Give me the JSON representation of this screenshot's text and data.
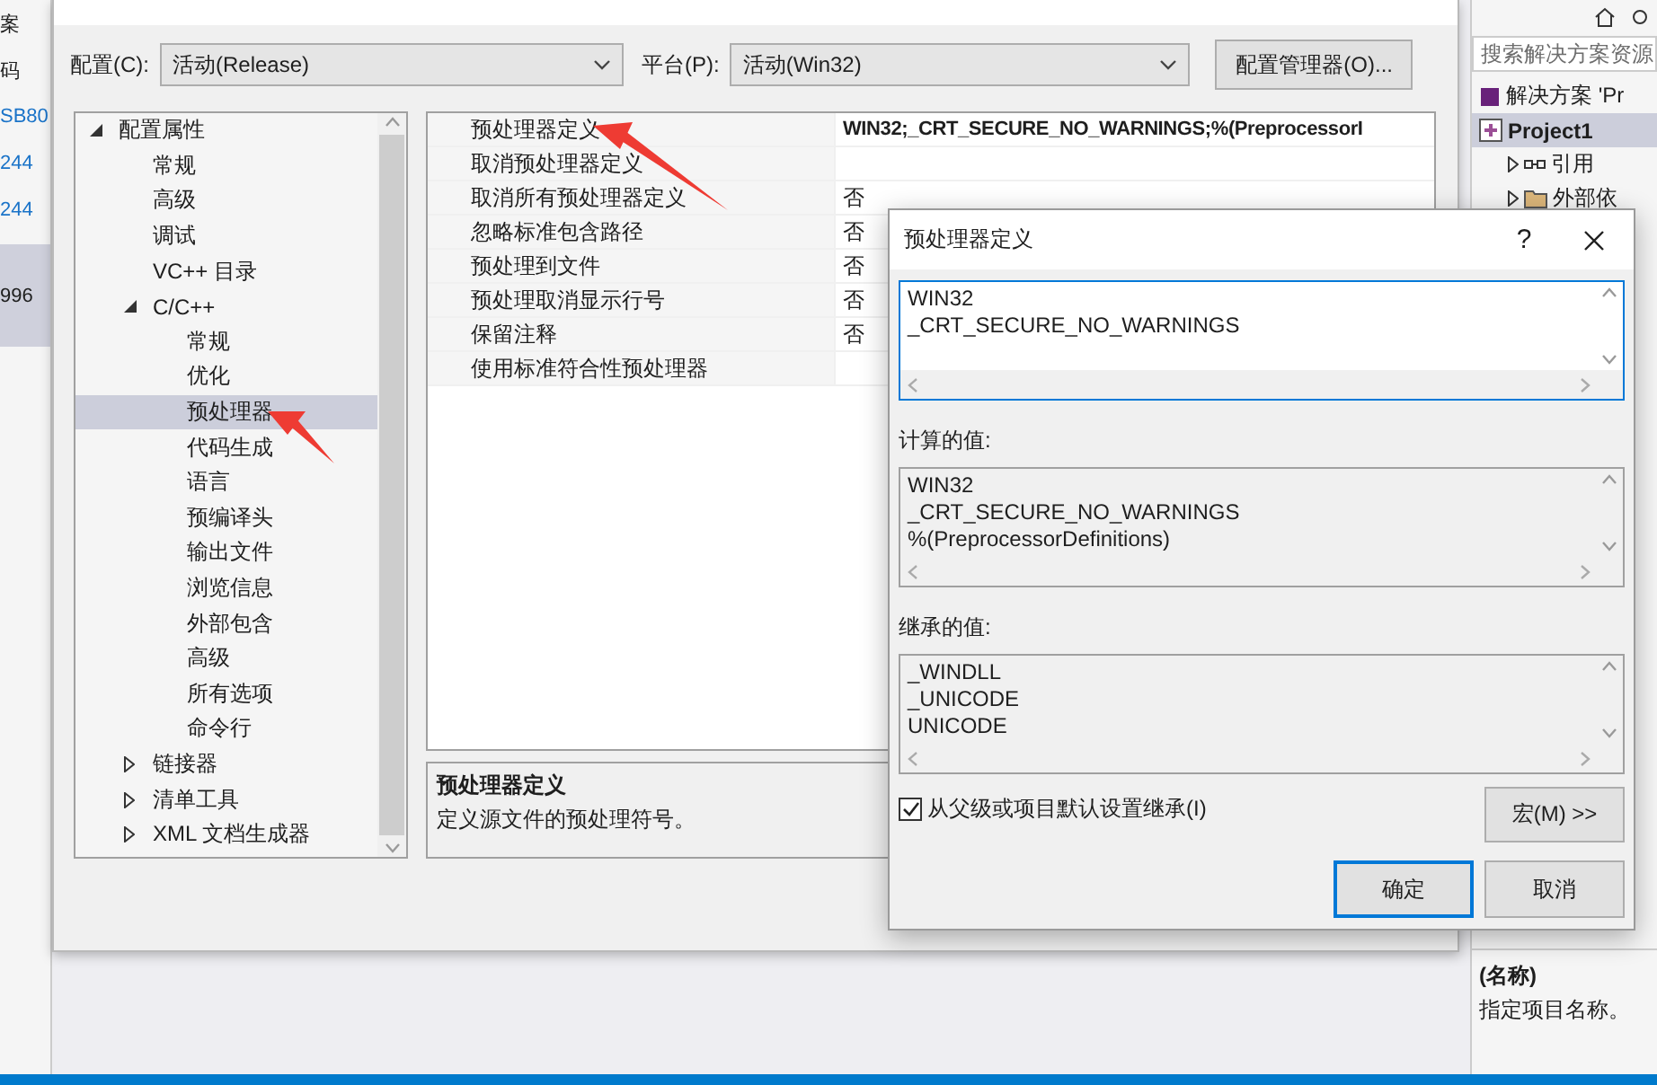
{
  "left_strip": [
    {
      "text": "案",
      "link": false,
      "selected": false
    },
    {
      "text": "码",
      "link": false,
      "selected": false
    },
    {
      "text": "SB80",
      "link": true,
      "selected": false
    },
    {
      "text": "244",
      "link": true,
      "selected": false
    },
    {
      "text": "244",
      "link": true,
      "selected": false
    },
    {
      "text": "996",
      "link": false,
      "selected": true
    }
  ],
  "config_bar": {
    "config_label": "配置(C):",
    "config_value": "活动(Release)",
    "platform_label": "平台(P):",
    "platform_value": "活动(Win32)",
    "manager_button": "配置管理器(O)..."
  },
  "tree": [
    {
      "label": "配置属性",
      "expanded": true,
      "selected": false,
      "children": [
        {
          "label": "常规",
          "selected": false
        },
        {
          "label": "高级",
          "selected": false
        },
        {
          "label": "调试",
          "selected": false
        },
        {
          "label": "VC++ 目录",
          "selected": false
        },
        {
          "label": "C/C++",
          "expanded": true,
          "selected": false,
          "children": [
            {
              "label": "常规",
              "selected": false
            },
            {
              "label": "优化",
              "selected": false
            },
            {
              "label": "预处理器",
              "selected": true
            },
            {
              "label": "代码生成",
              "selected": false
            },
            {
              "label": "语言",
              "selected": false
            },
            {
              "label": "预编译头",
              "selected": false
            },
            {
              "label": "输出文件",
              "selected": false
            },
            {
              "label": "浏览信息",
              "selected": false
            },
            {
              "label": "外部包含",
              "selected": false
            },
            {
              "label": "高级",
              "selected": false
            },
            {
              "label": "所有选项",
              "selected": false
            },
            {
              "label": "命令行",
              "selected": false
            }
          ]
        },
        {
          "label": "链接器",
          "expanded": false,
          "selected": false
        },
        {
          "label": "清单工具",
          "expanded": false,
          "selected": false
        },
        {
          "label": "XML 文档生成器",
          "expanded": false,
          "selected": false
        }
      ]
    }
  ],
  "properties": [
    {
      "name": "预处理器定义",
      "value": "WIN32;_CRT_SECURE_NO_WARNINGS;%(PreprocessorI",
      "overridden": true
    },
    {
      "name": "取消预处理器定义"
    },
    {
      "name": "取消所有预处理器定义",
      "value": "否",
      "overridden": false
    },
    {
      "name": "忽略标准包含路径",
      "value": "否",
      "overridden": false
    },
    {
      "name": "预处理到文件",
      "value": "否",
      "overridden": false
    },
    {
      "name": "预处理取消显示行号",
      "value": "否",
      "overridden": false
    },
    {
      "name": "保留注释",
      "value": "否",
      "overridden": false
    },
    {
      "name": "使用标准符合性预处理器"
    }
  ],
  "description": {
    "title": "预处理器定义",
    "text": "定义源文件的预处理符号。"
  },
  "solution_explorer": {
    "search_placeholder": "搜索解决方案资源",
    "items": [
      {
        "label": "解决方案 'Pr",
        "kind": "solution",
        "selected": false
      },
      {
        "label": "Project1",
        "kind": "project",
        "selected": true
      },
      {
        "label": "引用",
        "kind": "references",
        "selected": false
      },
      {
        "label": "外部依",
        "kind": "folder",
        "selected": false
      }
    ],
    "property_title": "(名称)",
    "property_text": "指定项目名称。"
  },
  "dialog": {
    "title": "预处理器定义",
    "help": "?",
    "definitions": [
      "WIN32",
      "_CRT_SECURE_NO_WARNINGS"
    ],
    "computed_label": "计算的值:",
    "computed": [
      "WIN32",
      "_CRT_SECURE_NO_WARNINGS",
      "%(PreprocessorDefinitions)"
    ],
    "inherited_label": "继承的值:",
    "inherited": [
      "_WINDLL",
      "_UNICODE",
      "UNICODE"
    ],
    "inherit_label": "从父级或项目默认设置继承(I)",
    "inherit_checked": true,
    "macro_button": "宏(M) >>",
    "ok_button": "确定",
    "cancel_button": "取消"
  }
}
